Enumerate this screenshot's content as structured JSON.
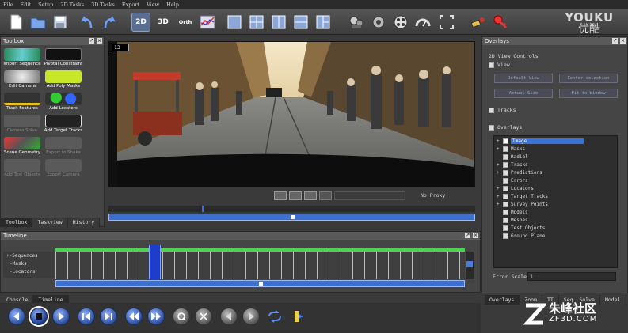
{
  "menu": [
    "File",
    "Edit",
    "Setup",
    "2D Tasks",
    "3D Tasks",
    "Export",
    "View",
    "Help"
  ],
  "toolbar": {
    "view_2d": "2D",
    "view_3d": "3D",
    "view_orth": "Orth"
  },
  "watermark": {
    "brand": "YOUKU",
    "brand_cn": "优酷",
    "site": "朱峰社区",
    "site_url": "ZF3D.COM"
  },
  "toolbox": {
    "title": "Toolbox",
    "tools": [
      {
        "label": "Import Sequence",
        "enabled": true
      },
      {
        "label": "Pivotal Constraint",
        "enabled": true
      },
      {
        "label": "Edit Camera",
        "enabled": true
      },
      {
        "label": "Add Poly Masks",
        "enabled": true
      },
      {
        "label": "Track Features",
        "enabled": true
      },
      {
        "label": "Add Locators",
        "enabled": true
      },
      {
        "label": "Camera Solve",
        "enabled": false
      },
      {
        "label": "Add Target Tracks",
        "enabled": true
      },
      {
        "label": "Scene Geometry",
        "enabled": true
      },
      {
        "label": "Export to Shake",
        "enabled": false
      },
      {
        "label": "Add Test Objects",
        "enabled": false
      },
      {
        "label": "Export Camera",
        "enabled": false
      }
    ],
    "tabs": [
      "Toolbox",
      "Taskview",
      "History"
    ]
  },
  "viewer": {
    "frame_number": "13",
    "proxy_label": "No Proxy"
  },
  "overlays_panel": {
    "title": "Overlays",
    "section_2d": "2D View Controls",
    "view_label": "View",
    "buttons": [
      "Default View",
      "Center selection",
      "Actual Size",
      "Fit to Window"
    ],
    "tracks_label": "Tracks",
    "overlays_label": "Overlays",
    "tree": [
      {
        "label": "Image",
        "checked": true,
        "selected": true,
        "expandable": true
      },
      {
        "label": "Masks",
        "checked": false,
        "selected": false,
        "expandable": true
      },
      {
        "label": "Radial",
        "checked": false,
        "selected": false,
        "expandable": false
      },
      {
        "label": "Tracks",
        "checked": false,
        "selected": false,
        "expandable": true
      },
      {
        "label": "Predictions",
        "checked": false,
        "selected": false,
        "expandable": true
      },
      {
        "label": "Errors",
        "checked": false,
        "selected": false,
        "expandable": false
      },
      {
        "label": "Locators",
        "checked": false,
        "selected": false,
        "expandable": true
      },
      {
        "label": "Target Tracks",
        "checked": false,
        "selected": false,
        "expandable": true
      },
      {
        "label": "Survey Points",
        "checked": false,
        "selected": false,
        "expandable": true
      },
      {
        "label": "Models",
        "checked": false,
        "selected": false,
        "expandable": false
      },
      {
        "label": "Meshes",
        "checked": false,
        "selected": false,
        "expandable": false
      },
      {
        "label": "Test Objects",
        "checked": false,
        "selected": false,
        "expandable": false
      },
      {
        "label": "Ground Plane",
        "checked": false,
        "selected": false,
        "expandable": false
      }
    ],
    "error_scale_label": "Error Scale",
    "error_scale_value": "1",
    "tabs": [
      "Overlays",
      "Zoom",
      "TT",
      "Seq. Solve",
      "Model"
    ]
  },
  "timeline": {
    "title": "Timeline",
    "items": [
      "Sequences",
      "Masks",
      "Locators"
    ],
    "tabs": [
      "Console",
      "Timeline"
    ]
  }
}
